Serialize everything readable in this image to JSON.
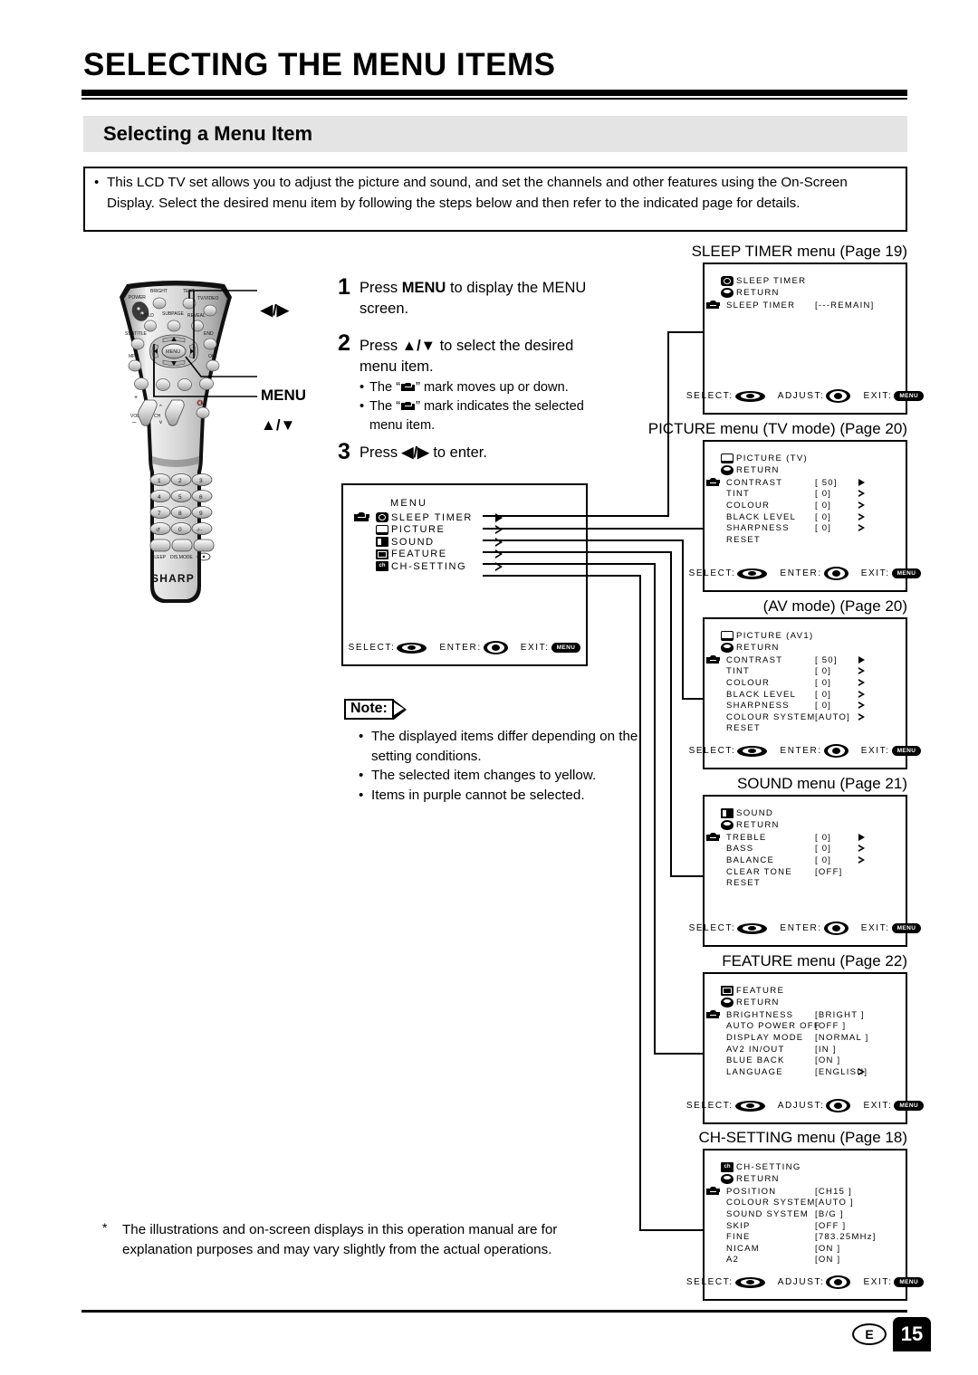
{
  "document": {
    "main_title": "SELECTING THE MENU ITEMS",
    "section_title": "Selecting a Menu Item",
    "intro_bullet": "•",
    "intro_text": "This LCD TV set allows you to adjust the picture and sound, and set the channels and other features using the On-Screen Display. Select the desired menu item by following the steps below and then refer to the indicated page for details.",
    "footnote_marker": "*",
    "footnote_text": "The illustrations and on-screen displays in this operation manual are for explanation purposes and may vary slightly from the actual operations.",
    "page_lang_code": "E",
    "page_number": "15"
  },
  "steps": [
    {
      "num": "1",
      "text_before": "Press ",
      "bold": "MENU",
      "text_after": " to display the MENU screen.",
      "subs": []
    },
    {
      "num": "2",
      "text_before": "Press ",
      "bold": "▲/▼",
      "text_after": " to select the desired menu item.",
      "subs": [
        {
          "bullet": "•",
          "pre": "The “",
          "post": "” mark moves up or down."
        },
        {
          "bullet": "•",
          "pre": "The “",
          "post": "” mark indicates the selected menu item."
        }
      ]
    },
    {
      "num": "3",
      "text_before": "Press ",
      "bold": "◀/▶",
      "text_after": " to enter.",
      "subs": []
    }
  ],
  "note": {
    "label": "Note:",
    "items": [
      "The displayed items differ depending on the setting conditions.",
      "The selected item changes to yellow.",
      "Items in purple cannot be selected."
    ],
    "bullet": "•"
  },
  "remote": {
    "brand": "SHARP",
    "buttons": [
      "POWER",
      "BRIGHT",
      "TEXT",
      "TV/VIDEO",
      "HOLD",
      "SUBPAGE",
      "REVEAL",
      "SUBTITLE",
      "END",
      "MPX",
      "OK",
      "MENU",
      "VOL",
      "CH",
      "SLEEP",
      "DIS.MODE"
    ],
    "keypad": [
      "1",
      "2",
      "3",
      "4",
      "5",
      "6",
      "7",
      "8",
      "9",
      "0"
    ],
    "callouts": [
      {
        "name": "left-right",
        "label": "◀/▶"
      },
      {
        "name": "menu",
        "label": "MENU"
      },
      {
        "name": "up-down",
        "label": "▲/▼"
      }
    ]
  },
  "menu_screen": {
    "title": "MENU",
    "items": [
      {
        "icon": "clock-icon",
        "label": "SLEEP TIMER",
        "arrow": "solid",
        "selected": true
      },
      {
        "icon": "tv-icon",
        "label": "PICTURE",
        "arrow": "hollow",
        "selected": false
      },
      {
        "icon": "speaker-icon",
        "label": "SOUND",
        "arrow": "hollow",
        "selected": false
      },
      {
        "icon": "feature-icon",
        "label": "FEATURE",
        "arrow": "hollow",
        "selected": false
      },
      {
        "icon": "ch-icon",
        "label": "CH-SETTING",
        "arrow": "hollow",
        "selected": false
      }
    ],
    "footer": {
      "select": "SELECT:",
      "enter": "ENTER:",
      "exit": "EXIT:",
      "exit_button": "MENU"
    }
  },
  "panels": [
    {
      "id": "sleep-timer",
      "caption_plain": "SLEEP TIMER menu (Page 19)",
      "head_icon": "clock-icon",
      "head_title": "SLEEP TIMER",
      "return_label": "RETURN",
      "rows": [
        {
          "name": "SLEEP TIMER",
          "value": "[---REMAIN]",
          "arrow": "none",
          "selected": true
        }
      ],
      "footer": {
        "select": "SELECT:",
        "middle": "ADJUST:",
        "exit": "EXIT:",
        "exit_button": "MENU"
      }
    },
    {
      "id": "picture-tv",
      "caption_plain": "PICTURE menu (TV mode) (Page 20)",
      "head_icon": "tv-icon",
      "head_title": "PICTURE (TV)",
      "return_label": "RETURN",
      "rows": [
        {
          "name": "CONTRAST",
          "value": "[  50]",
          "arrow": "solid",
          "selected": true
        },
        {
          "name": "TINT",
          "value": "[   0]",
          "arrow": "hollow",
          "selected": false
        },
        {
          "name": "COLOUR",
          "value": "[   0]",
          "arrow": "hollow",
          "selected": false
        },
        {
          "name": "BLACK LEVEL",
          "value": "[   0]",
          "arrow": "hollow",
          "selected": false
        },
        {
          "name": "SHARPNESS",
          "value": "[   0]",
          "arrow": "hollow",
          "selected": false
        },
        {
          "name": "RESET",
          "value": "",
          "arrow": "none",
          "selected": false
        }
      ],
      "footer": {
        "select": "SELECT:",
        "middle": "ENTER:",
        "exit": "EXIT:",
        "exit_button": "MENU"
      }
    },
    {
      "id": "picture-av",
      "caption_plain": "(AV mode) (Page 20)",
      "head_icon": "tv-icon",
      "head_title": "PICTURE (AV1)",
      "return_label": "RETURN",
      "rows": [
        {
          "name": "CONTRAST",
          "value": "[  50]",
          "arrow": "solid",
          "selected": true
        },
        {
          "name": "TINT",
          "value": "[   0]",
          "arrow": "hollow",
          "selected": false
        },
        {
          "name": "COLOUR",
          "value": "[   0]",
          "arrow": "hollow",
          "selected": false
        },
        {
          "name": "BLACK LEVEL",
          "value": "[   0]",
          "arrow": "hollow",
          "selected": false
        },
        {
          "name": "SHARPNESS",
          "value": "[   0]",
          "arrow": "hollow",
          "selected": false
        },
        {
          "name": "COLOUR SYSTEM",
          "value": "[AUTO]",
          "arrow": "hollow",
          "selected": false
        },
        {
          "name": "RESET",
          "value": "",
          "arrow": "none",
          "selected": false
        }
      ],
      "footer": {
        "select": "SELECT:",
        "middle": "ENTER:",
        "exit": "EXIT:",
        "exit_button": "MENU"
      }
    },
    {
      "id": "sound",
      "caption_plain": "SOUND menu (Page 21)",
      "head_icon": "speaker-icon",
      "head_title": "SOUND",
      "return_label": "RETURN",
      "rows": [
        {
          "name": "TREBLE",
          "value": "[   0]",
          "arrow": "solid",
          "selected": true
        },
        {
          "name": "BASS",
          "value": "[   0]",
          "arrow": "hollow",
          "selected": false
        },
        {
          "name": "BALANCE",
          "value": "[   0]",
          "arrow": "hollow",
          "selected": false
        },
        {
          "name": "CLEAR TONE",
          "value": "[OFF]",
          "arrow": "none",
          "selected": false
        },
        {
          "name": "RESET",
          "value": "",
          "arrow": "none",
          "selected": false
        }
      ],
      "footer": {
        "select": "SELECT:",
        "middle": "ENTER:",
        "exit": "EXIT:",
        "exit_button": "MENU"
      }
    },
    {
      "id": "feature",
      "caption_plain": "FEATURE menu (Page 22)",
      "head_icon": "feature-icon",
      "head_title": "FEATURE",
      "return_label": "RETURN",
      "rows": [
        {
          "name": "BRIGHTNESS",
          "value": "[BRIGHT ]",
          "arrow": "none",
          "selected": true
        },
        {
          "name": "AUTO POWER OFF",
          "value": "[OFF    ]",
          "arrow": "none",
          "selected": false
        },
        {
          "name": "DISPLAY MODE",
          "value": "[NORMAL ]",
          "arrow": "none",
          "selected": false
        },
        {
          "name": "AV2 IN/OUT",
          "value": "[IN     ]",
          "arrow": "none",
          "selected": false
        },
        {
          "name": "BLUE BACK",
          "value": "[ON     ]",
          "arrow": "none",
          "selected": false
        },
        {
          "name": "LANGUAGE",
          "value": "[ENGLISH]",
          "arrow": "hollow",
          "selected": false
        }
      ],
      "footer": {
        "select": "SELECT:",
        "middle": "ADJUST:",
        "exit": "EXIT:",
        "exit_button": "MENU"
      }
    },
    {
      "id": "ch-setting",
      "caption_plain": "CH-SETTING menu (Page 18)",
      "head_icon": "ch-icon",
      "head_title": "CH-SETTING",
      "return_label": "RETURN",
      "rows": [
        {
          "name": "POSITION",
          "value": "[CH15   ]",
          "arrow": "none",
          "selected": true
        },
        {
          "name": "COLOUR SYSTEM",
          "value": "[AUTO   ]",
          "arrow": "none",
          "selected": false
        },
        {
          "name": "SOUND SYSTEM",
          "value": "[B/G    ]",
          "arrow": "none",
          "selected": false
        },
        {
          "name": "SKIP",
          "value": "[OFF    ]",
          "arrow": "none",
          "selected": false
        },
        {
          "name": "FINE",
          "value": "[783.25MHz]",
          "arrow": "none",
          "selected": false
        },
        {
          "name": "NICAM",
          "value": "[ON     ]",
          "arrow": "none",
          "selected": false
        },
        {
          "name": "A2",
          "value": "[ON     ]",
          "arrow": "none",
          "selected": false
        }
      ],
      "footer": {
        "select": "SELECT:",
        "middle": "ADJUST:",
        "exit": "EXIT:",
        "exit_button": "MENU"
      }
    }
  ]
}
